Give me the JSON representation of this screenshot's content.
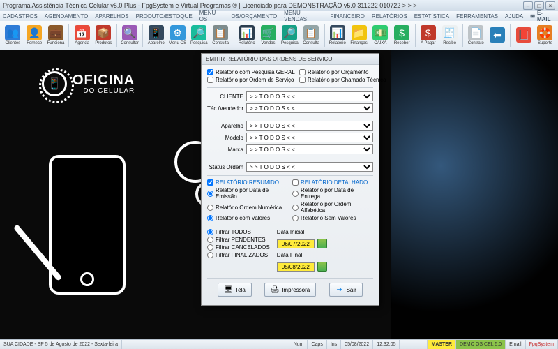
{
  "window": {
    "title": "Programa Assistência Técnica Celular v5.0 Plus - FpgSystem e Virtual Programas ® | Licenciado para  DEMONSTRAÇÃO v5.0 311222 010722 > > >"
  },
  "menu": {
    "items": [
      "CADASTROS",
      "AGENDAMENTO",
      "APARELHOS",
      "PRODUTO/ESTOQUE",
      "MENU OS",
      "OS/ORÇAMENTO",
      "MENU VENDAS",
      "FINANCEIRO",
      "RELATÓRIOS",
      "ESTATÍSTICA",
      "FERRAMENTAS",
      "AJUDA"
    ],
    "email": "E-MAIL"
  },
  "toolbar": [
    {
      "label": "Clientes",
      "icon": "👥",
      "bg": "#2e7bd6"
    },
    {
      "label": "Fornece",
      "icon": "👤",
      "bg": "#f5a623"
    },
    {
      "label": "Funciona",
      "icon": "💼",
      "bg": "#8b5a2b"
    },
    {
      "label": "Agenda",
      "icon": "📅",
      "bg": "#e74c3c"
    },
    {
      "label": "Produtos",
      "icon": "📦",
      "bg": "#c0392b"
    },
    {
      "label": "Consultar",
      "icon": "🔍",
      "bg": "#9b59b6"
    },
    {
      "label": "Aparelho",
      "icon": "📱",
      "bg": "#34495e"
    },
    {
      "label": "Menu OS",
      "icon": "⚙",
      "bg": "#3498db"
    },
    {
      "label": "Pesquisa",
      "icon": "🔎",
      "bg": "#1abc9c"
    },
    {
      "label": "Consulta",
      "icon": "📋",
      "bg": "#7f8c8d"
    },
    {
      "label": "Relatório",
      "icon": "📊",
      "bg": "#2c3e50"
    },
    {
      "label": "Vendas",
      "icon": "🛒",
      "bg": "#27ae60"
    },
    {
      "label": "Pesquisa",
      "icon": "🔎",
      "bg": "#16a085"
    },
    {
      "label": "Consulta",
      "icon": "📋",
      "bg": "#95a5a6"
    },
    {
      "label": "Relatório",
      "icon": "📊",
      "bg": "#34495e"
    },
    {
      "label": "Finanças",
      "icon": "📁",
      "bg": "#f1c40f"
    },
    {
      "label": "CAIXA",
      "icon": "💵",
      "bg": "#2ecc71"
    },
    {
      "label": "Receber",
      "icon": "$",
      "bg": "#27ae60"
    },
    {
      "label": "A Pagar",
      "icon": "$",
      "bg": "#c0392b"
    },
    {
      "label": "Recibo",
      "icon": "🧾",
      "bg": "#ecf0f1"
    },
    {
      "label": "Contrato",
      "icon": "📄",
      "bg": "#bdc3c7"
    },
    {
      "label": "",
      "icon": "⬅",
      "bg": "#2980b9"
    },
    {
      "label": "",
      "icon": "📕",
      "bg": "#e74c3c"
    },
    {
      "label": "Suporte",
      "icon": "🛟",
      "bg": "#e67e22"
    }
  ],
  "brand": {
    "line1": "OFICINA",
    "line2": "DO CELULAR"
  },
  "dialog": {
    "title": "EMITIR RELATÓRIO DAS ORDENS DE SERVIÇO",
    "top_checks": {
      "geral": "Relatório com Pesquisa GERAL",
      "orcamento": "Relatório por Orçamento",
      "ordem": "Relatório por Ordem de Serviço",
      "chamado": "Relatório por Chamado Técnico"
    },
    "fields": {
      "cliente_label": "CLIENTE",
      "tec_label": "Téc./Vendedor",
      "aparelho_label": "Aparelho",
      "modelo_label": "Modelo",
      "marca_label": "Marca",
      "status_label": "Status Ordem",
      "todos": "> > T O D O S < <"
    },
    "summary": {
      "resumido": "RELATÓRIO RESUMIDO",
      "detalhado": "RELATÓRIO DETALHADO",
      "emissao": "Relatório por Data de Emissão",
      "entrega": "Relatório por Data de Entrega",
      "numerica": "Relatório Ordem Numérica",
      "alfabetica": "Relatório por Ordem Alfabética",
      "com_valores": "Relatório com Valores",
      "sem_valores": "Relatório Sem Valores"
    },
    "filters": {
      "todos": "Filtrar TODOS",
      "pendentes": "Filtrar PENDENTES",
      "cancelados": "Filtrar CANCELADOS",
      "finalizados": "Filtrar FINALIZADOS",
      "data_inicial_label": "Data Inicial",
      "data_inicial": "06/07/2022",
      "data_final_label": "Data Final",
      "data_final": "05/08/2022"
    },
    "buttons": {
      "tela": "Tela",
      "impressora": "Impressora",
      "sair": "Sair"
    }
  },
  "status": {
    "location": "SUA CIDADE - SP  5 de Agosto de 2022 - Sexta-feira",
    "num": "Num",
    "caps": "Caps",
    "ins": "Ins",
    "date": "05/08/2022",
    "time": "12:32:05",
    "master": "MASTER",
    "demo": "DEMO OS CEL 5.0",
    "email": "Email",
    "fpq": "FpqSystem"
  }
}
